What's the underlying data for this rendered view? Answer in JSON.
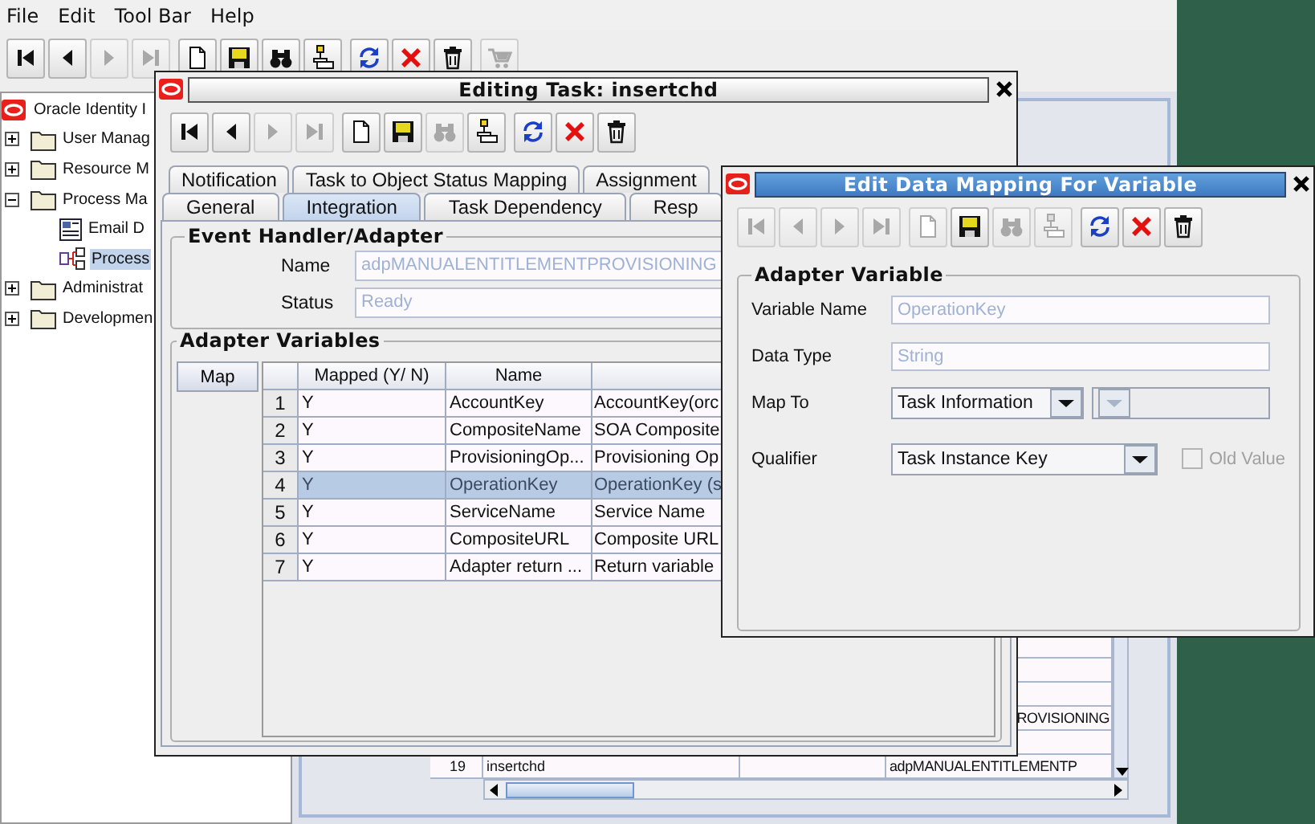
{
  "menu_bar": [
    {
      "label": "File"
    },
    {
      "label": "Edit"
    },
    {
      "label": "Tool Bar"
    },
    {
      "label": "Help"
    }
  ],
  "toolbar": [
    [
      {
        "kind": "first",
        "disabled": false
      },
      {
        "kind": "previous",
        "disabled": false
      },
      {
        "kind": "next",
        "disabled": true
      },
      {
        "kind": "last",
        "disabled": true
      }
    ],
    [
      {
        "kind": "new",
        "disabled": false
      },
      {
        "kind": "save",
        "disabled": false
      },
      {
        "kind": "find",
        "disabled": false
      },
      {
        "kind": "stamp",
        "disabled": false
      }
    ],
    [
      {
        "kind": "refresh",
        "disabled": false
      },
      {
        "kind": "delete",
        "disabled": false
      },
      {
        "kind": "trash",
        "disabled": false
      }
    ],
    [
      {
        "kind": "cart",
        "disabled": true
      }
    ]
  ],
  "tree": {
    "label": "Oracle Identity I",
    "children": [
      {
        "label": "User Manag",
        "kind": "folder",
        "expanded": false,
        "selected": false
      },
      {
        "label": "Resource M",
        "kind": "folder",
        "expanded": false,
        "selected": false
      },
      {
        "label": "Process Ma",
        "kind": "folder",
        "expanded": true,
        "selected": false,
        "children": [
          {
            "label": "Email D",
            "kind": "email",
            "selected": false
          },
          {
            "label": "Process",
            "kind": "process",
            "selected": true
          }
        ]
      },
      {
        "label": "Administrat",
        "kind": "folder",
        "expanded": false,
        "selected": false
      },
      {
        "label": "Developmen",
        "kind": "folder",
        "expanded": false,
        "selected": false
      }
    ]
  },
  "background_table": {
    "rows": [
      {},
      {},
      {},
      {},
      {
        "column_4": "ROVISIONING"
      },
      {},
      {
        "number": "19",
        "column_2": "insertchd",
        "column_4": "adpMANUALENTITLEMENTP"
      }
    ]
  },
  "editing_window": {
    "title": "Editing Task: insertchd",
    "active": false,
    "toolbar": [
      [
        {
          "kind": "first",
          "disabled": false
        },
        {
          "kind": "previous",
          "disabled": false
        },
        {
          "kind": "next",
          "disabled": true
        },
        {
          "kind": "last",
          "disabled": true
        }
      ],
      [
        {
          "kind": "new",
          "disabled": false
        },
        {
          "kind": "save",
          "disabled": false
        },
        {
          "kind": "find",
          "disabled": true
        },
        {
          "kind": "stamp",
          "disabled": false
        }
      ],
      [
        {
          "kind": "refresh",
          "disabled": false
        },
        {
          "kind": "delete",
          "disabled": false
        },
        {
          "kind": "trash",
          "disabled": false
        }
      ]
    ],
    "tab_rows": [
      [
        {
          "label": "Notification",
          "selected": false
        },
        {
          "label": "Task to Object Status Mapping",
          "selected": false
        },
        {
          "label": "Assignment",
          "selected": false
        }
      ],
      [
        {
          "label": "General",
          "selected": false
        },
        {
          "label": "Integration",
          "selected": true
        },
        {
          "label": "Task Dependency",
          "selected": false
        },
        {
          "label": "Resp",
          "selected": false
        }
      ]
    ],
    "event_handler": {
      "title": "Event Handler/Adapter",
      "fields": [
        {
          "label": "Name",
          "value": "adpMANUALENTITLEMENTPROVISIONING",
          "disabled": true
        },
        {
          "label": "Status",
          "value": "Ready",
          "disabled": true
        }
      ]
    },
    "adapter_variables": {
      "title": "Adapter Variables",
      "map_button": "Map",
      "columns": [
        "Mapped (Y/ N)",
        "Name"
      ],
      "rows": [
        {
          "number": "1",
          "mapped": "Y",
          "name": "AccountKey",
          "column_4": "AccountKey(orc",
          "selected": false
        },
        {
          "number": "2",
          "mapped": "Y",
          "name": "CompositeName",
          "column_4": "SOA Composite",
          "selected": false
        },
        {
          "number": "3",
          "mapped": "Y",
          "name": "ProvisioningOp...",
          "column_4": "Provisioning Op",
          "selected": false
        },
        {
          "number": "4",
          "mapped": "Y",
          "name": "OperationKey",
          "column_4": "OperationKey (s",
          "selected": true
        },
        {
          "number": "5",
          "mapped": "Y",
          "name": "ServiceName",
          "column_4": "Service Name",
          "selected": false
        },
        {
          "number": "6",
          "mapped": "Y",
          "name": "CompositeURL",
          "column_4": "Composite URL",
          "selected": false
        },
        {
          "number": "7",
          "mapped": "Y",
          "name": "Adapter return ...",
          "column_4": "Return variable",
          "selected": false
        }
      ]
    }
  },
  "dialog": {
    "title": "Edit Data Mapping For Variable",
    "active": true,
    "toolbar": [
      [
        {
          "kind": "first",
          "disabled": true
        },
        {
          "kind": "previous",
          "disabled": true
        },
        {
          "kind": "next",
          "disabled": true
        },
        {
          "kind": "last",
          "disabled": true
        }
      ],
      [
        {
          "kind": "new",
          "disabled": true
        },
        {
          "kind": "save",
          "disabled": false
        },
        {
          "kind": "find",
          "disabled": true
        },
        {
          "kind": "stamp",
          "disabled": true
        }
      ],
      [
        {
          "kind": "refresh",
          "disabled": false
        },
        {
          "kind": "delete",
          "disabled": false
        },
        {
          "kind": "trash",
          "disabled": false
        }
      ]
    ],
    "group_title": "Adapter Variable",
    "rows": [
      {
        "label": "Variable Name",
        "kind": "text",
        "value": "OperationKey",
        "disabled": true
      },
      {
        "label": "Data Type",
        "kind": "text",
        "value": "String",
        "disabled": true
      },
      {
        "label": "Map To",
        "kind": "combo",
        "controls": [
          {
            "value": "Task Information",
            "disabled": false
          },
          {
            "disabled": true
          }
        ]
      },
      {
        "label": "Qualifier",
        "kind": "combo",
        "controls": [
          {
            "value": "Task Instance Key",
            "disabled": false
          }
        ],
        "checkbox": {
          "label": "Old Value",
          "checked": false,
          "disabled": true
        }
      }
    ]
  }
}
